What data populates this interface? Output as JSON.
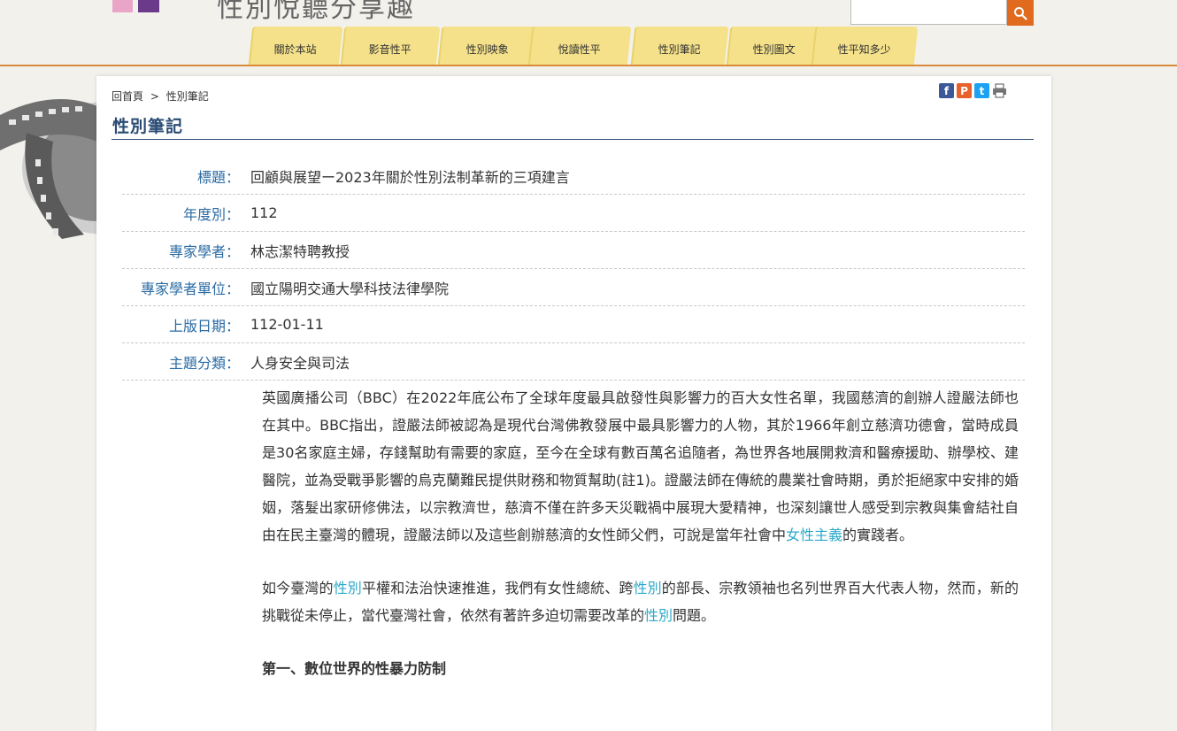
{
  "header": {
    "site_title": "性別悅聽分享趣",
    "search_placeholder": "",
    "nav": [
      "關於本站",
      "影音性平",
      "性別映象",
      "悅讀性平",
      "性別筆記",
      "性別圖文",
      "性平知多少"
    ]
  },
  "breadcrumb": {
    "home": "回首頁",
    "sep": ">",
    "current": "性別筆記"
  },
  "share": [
    "f",
    "P",
    "t",
    "print"
  ],
  "page_title": "性別筆記",
  "info": [
    {
      "label": "標題：",
      "value": "回顧與展望ー2023年關於性別法制革新的三項建言"
    },
    {
      "label": "年度別：",
      "value": "112"
    },
    {
      "label": "專家學者：",
      "value": "林志潔特聘教授"
    },
    {
      "label": "專家學者單位：",
      "value": "國立陽明交通大學科技法律學院"
    },
    {
      "label": "上版日期：",
      "value": "112-01-11"
    },
    {
      "label": "主題分類：",
      "value": "人身安全與司法"
    }
  ],
  "body": {
    "p1_a": "英國廣播公司（BBC）在2022年底公布了全球年度最具啟發性與影響力的百大女性名單，我國慈濟的創辦人證嚴法師也在其中。BBC指出，證嚴法師被認為是現代台灣佛教發展中最具影響力的人物，其於1966年創立慈濟功德會，當時成員是30名家庭主婦，存錢幫助有需要的家庭，至今在全球有數百萬名追隨者，為世界各地展開救濟和醫療援助、辦學校、建醫院，並為受戰爭影響的烏克蘭難民提供財務和物質幫助(註1)。證嚴法師在傳統的農業社會時期，勇於拒絕家中安排的婚姻，落髮出家研修佛法，以宗教濟世，慈濟不僅在許多天災戰禍中展現大愛精神，也深刻讓世人感受到宗教與集會結社自由在民主臺灣的體現，證嚴法師以及這些創辦慈濟的女性師父們，可說是當年社會中",
    "p1_link": "女性主義",
    "p1_b": "的實踐者。",
    "p2_a": "如今臺灣的",
    "p2_link1": "性別",
    "p2_b": "平權和法治快速推進，我們有女性總統、跨",
    "p2_link2": "性別",
    "p2_c": "的部長、宗教領袖也名列世界百大代表人物，然而，新的挑戰從未停止，當代臺灣社會，依然有著許多迫切需要改革的",
    "p2_link3": "性別",
    "p2_d": "問題。",
    "h1": "第一、數位世界的性暴力防制"
  }
}
